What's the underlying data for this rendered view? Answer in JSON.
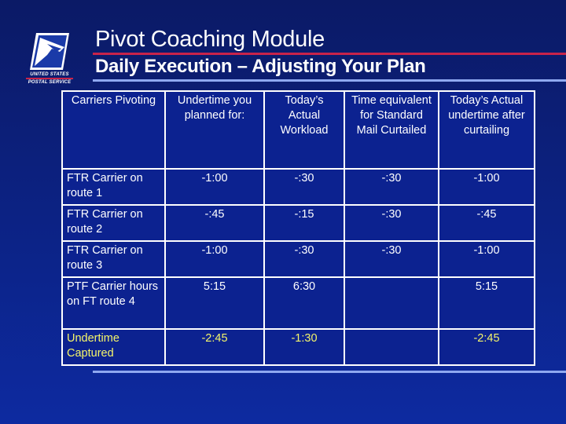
{
  "logo": {
    "icon": "eagle-icon",
    "line1": "UNITED STATES",
    "line2": "POSTAL SERVICE"
  },
  "header": {
    "title": "Pivot Coaching Module",
    "subtitle": "Daily Execution – Adjusting Your Plan"
  },
  "colors": {
    "background": "#0c2180",
    "title_rule": "#c8234a",
    "subtitle_rule": "#8fa8f0",
    "highlight_text": "#f5f56a"
  },
  "table": {
    "headers": [
      "Carriers Pivoting",
      "Undertime you planned for:",
      "Today’s Actual Workload",
      "Time equivalent for Standard Mail Curtailed",
      "Today’s Actual undertime after curtailing"
    ],
    "rows": [
      [
        "FTR Carrier on route 1",
        "-1:00",
        "-:30",
        "-:30",
        "-1:00"
      ],
      [
        "FTR Carrier on route 2",
        "-:45",
        "-:15",
        "-:30",
        "-:45"
      ],
      [
        "FTR Carrier on route 3",
        "-1:00",
        "-:30",
        "-:30",
        "-1:00"
      ],
      [
        "PTF Carrier hours on FT route 4",
        "5:15",
        "6:30",
        "",
        "5:15"
      ],
      [
        "Undertime Captured",
        "-2:45",
        "-1:30",
        "",
        "-2:45"
      ]
    ]
  }
}
